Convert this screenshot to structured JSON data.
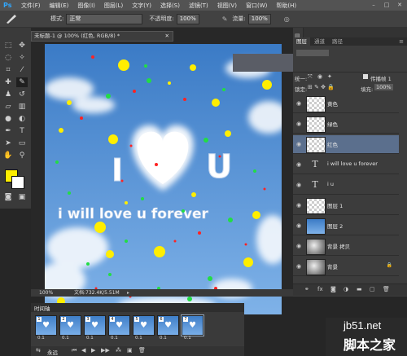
{
  "menubar": {
    "logo": "Ps",
    "items": [
      "文件(F)",
      "编辑(E)",
      "图像(I)",
      "图层(L)",
      "文字(Y)",
      "选择(S)",
      "滤镜(T)",
      "视图(V)",
      "窗口(W)",
      "帮助(H)"
    ]
  },
  "options": {
    "mode_label": "模式:",
    "mode_value": "正常",
    "opacity_label": "不透明度:",
    "opacity_value": "100%",
    "flow_label": "流量:",
    "flow_value": "100%"
  },
  "document": {
    "tab_title": "未标题-1 @ 100% (红色, RGB/8) *",
    "zoom": "100%",
    "doc_info": "文档:732.4K/5.51M",
    "canvas_text_iu_left": "I",
    "canvas_text_iu_right": "U",
    "canvas_sentence": "i will love u forever"
  },
  "panels": {
    "tabs": [
      "图层",
      "通道",
      "路径"
    ],
    "unify_label": "统一:",
    "propagate_label": "传播帧 1",
    "lock_label": "锁定:",
    "fill_label": "填充:",
    "fill_value": "100%"
  },
  "layers": [
    {
      "name": "黄色",
      "type": "pixel",
      "thumb": "checker",
      "selected": false
    },
    {
      "name": "绿色",
      "type": "pixel",
      "thumb": "checker",
      "selected": false
    },
    {
      "name": "红色",
      "type": "pixel",
      "thumb": "checker",
      "selected": true
    },
    {
      "name": "i will love u forever",
      "type": "text",
      "thumb": "T",
      "selected": false
    },
    {
      "name": "i u",
      "type": "text",
      "thumb": "T",
      "selected": false
    },
    {
      "name": "图层 1",
      "type": "pixel",
      "thumb": "checker",
      "selected": false
    },
    {
      "name": "图层 2",
      "type": "pixel",
      "thumb": "blue",
      "selected": false
    },
    {
      "name": "背景 拷贝",
      "type": "pixel",
      "thumb": "cloud",
      "selected": false
    },
    {
      "name": "背景",
      "type": "pixel",
      "thumb": "cloud",
      "selected": false,
      "locked": true
    }
  ],
  "timeline": {
    "title": "时间轴",
    "loop": "永远",
    "frames": [
      {
        "num": "1",
        "delay": "0.1"
      },
      {
        "num": "2",
        "delay": "0.1"
      },
      {
        "num": "3",
        "delay": "0.1"
      },
      {
        "num": "4",
        "delay": "0.1"
      },
      {
        "num": "5",
        "delay": "0.1"
      },
      {
        "num": "6",
        "delay": "0.1"
      },
      {
        "num": "7",
        "delay": "0.1"
      }
    ]
  },
  "watermark": {
    "line1": "jb51.net",
    "line2": "脚本之家"
  },
  "colors": {
    "foreground": "#ffee00",
    "background": "#ffffff",
    "sky_top": "#3b7bc6",
    "sky_bottom": "#7fb2e8",
    "selection": "#5b6f8d"
  },
  "icons": [
    "brush-icon",
    "eye-icon",
    "text-layer-icon",
    "lock-icon",
    "play-icon",
    "move-icon",
    "marquee-icon",
    "lasso-icon",
    "crop-icon",
    "eyedropper-icon",
    "stamp-icon",
    "eraser-icon",
    "gradient-icon",
    "pen-icon",
    "type-icon",
    "hand-icon",
    "zoom-icon"
  ]
}
